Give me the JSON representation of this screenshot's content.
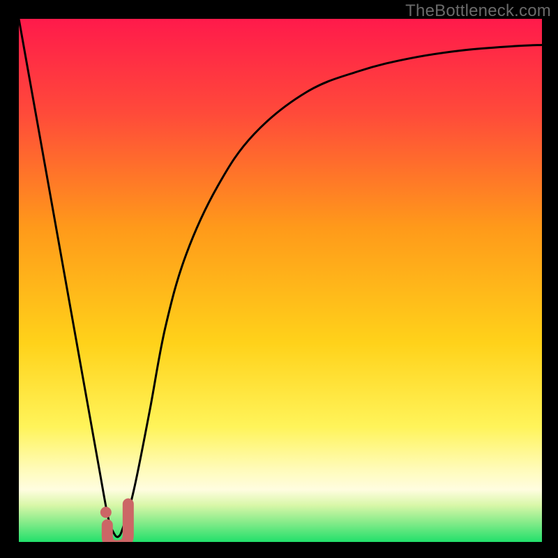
{
  "watermark": "TheBottleneck.com",
  "colors": {
    "frame": "#000000",
    "gradient_top": "#ff1a4b",
    "gradient_mid": "#ffbb00",
    "gradient_low": "#fff45a",
    "gradient_band": "#fffde0",
    "gradient_bottom": "#22e06b",
    "curve": "#000000",
    "marker": "#cc6666"
  },
  "chart_data": {
    "type": "line",
    "title": "",
    "xlabel": "",
    "ylabel": "",
    "xlim": [
      0,
      100
    ],
    "ylim": [
      0,
      100
    ],
    "series": [
      {
        "name": "bottleneck-curve",
        "x": [
          0,
          5,
          10,
          15,
          17,
          18,
          19,
          20,
          22,
          25,
          28,
          32,
          38,
          45,
          55,
          65,
          75,
          85,
          95,
          100
        ],
        "values": [
          100,
          72,
          44,
          16,
          5,
          2,
          1,
          3,
          10,
          25,
          41,
          55,
          68,
          78,
          86,
          90,
          92.5,
          94,
          94.8,
          95
        ]
      }
    ],
    "annotations": [
      {
        "name": "j-marker",
        "type": "marker",
        "shape": "J",
        "x": 18.5,
        "y": 3,
        "color": "#cc6666"
      }
    ]
  }
}
